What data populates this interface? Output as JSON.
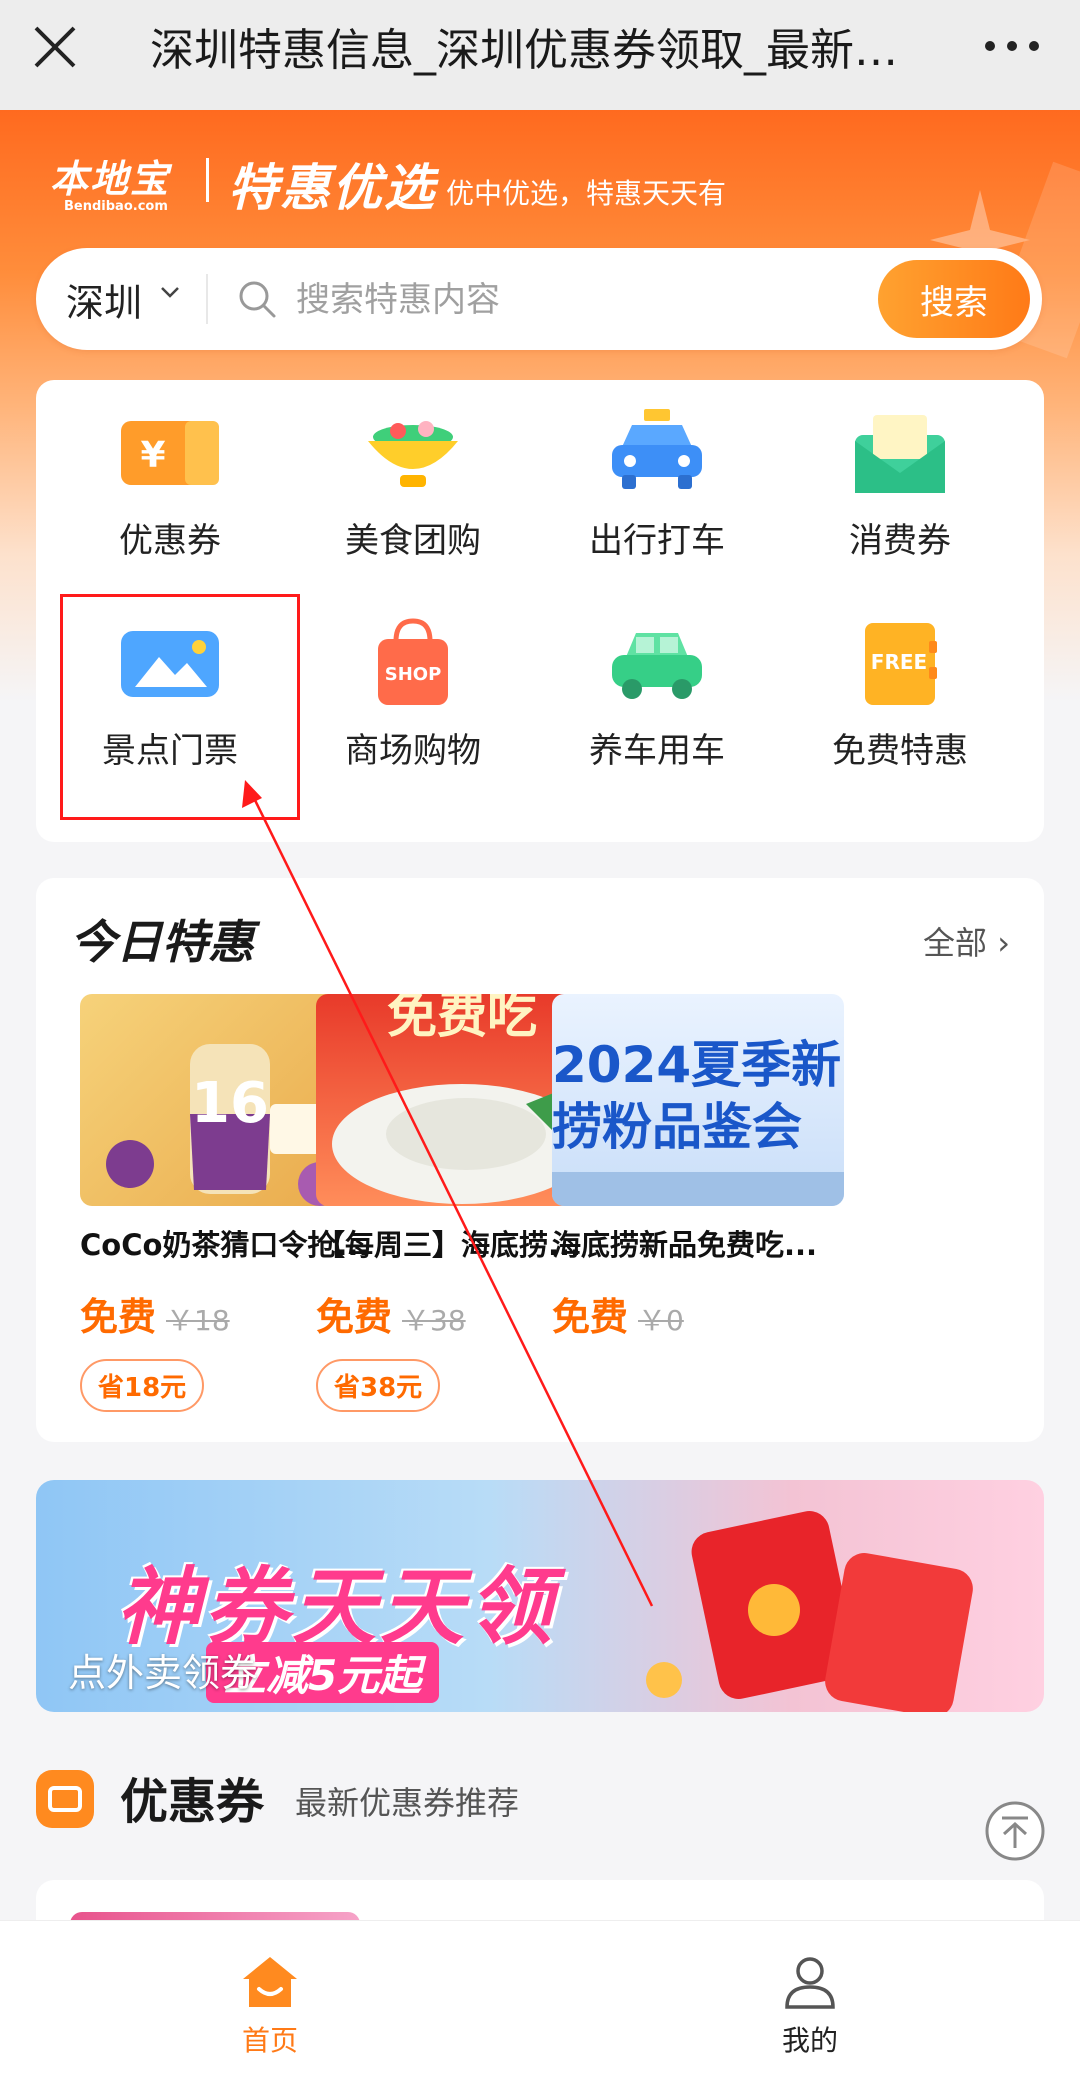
{
  "titlebar": {
    "title": "深圳特惠信息_深圳优惠券领取_最新深圳特惠活动"
  },
  "brand": {
    "logo_cn": "本地宝",
    "logo_en": "Bendibao.com",
    "title": "特惠优选",
    "slogan": "优中优选，特惠天天有"
  },
  "search": {
    "city": "深圳",
    "placeholder": "搜索特惠内容",
    "button": "搜索"
  },
  "categories": [
    {
      "label": "优惠券",
      "icon": "coupon-ticket-icon"
    },
    {
      "label": "美食团购",
      "icon": "food-bowl-icon"
    },
    {
      "label": "出行打车",
      "icon": "taxi-icon"
    },
    {
      "label": "消费券",
      "icon": "voucher-envelope-icon"
    },
    {
      "label": "景点门票",
      "icon": "scenery-photo-icon"
    },
    {
      "label": "商场购物",
      "icon": "shopping-bag-icon",
      "badge": "SHOP"
    },
    {
      "label": "养车用车",
      "icon": "car-icon"
    },
    {
      "label": "免费特惠",
      "icon": "free-notebook-icon",
      "badge": "FREE"
    }
  ],
  "today": {
    "title": "今日特惠",
    "all_link": "全部",
    "deals": [
      {
        "name": "CoCo奶茶猜口令抢...",
        "price": "免费",
        "original": "￥18",
        "save": "省18元",
        "thumb_text": "16"
      },
      {
        "name": "【每周三】海底捞...",
        "price": "免费",
        "original": "￥38",
        "save": "省38元",
        "thumb_text": "免费吃"
      },
      {
        "name": "海底捞新品免费吃...",
        "price": "免费",
        "original": "￥0",
        "thumb_text_1": "2024夏季新",
        "thumb_text_2": "捞粉品鉴会"
      }
    ]
  },
  "banner": {
    "headline": "神券天天领",
    "sub": "立减5元起",
    "caption": "点外卖领券"
  },
  "coupons": {
    "title": "优惠券",
    "subtitle": "最新优惠券推荐"
  },
  "bottom_nav": [
    {
      "label": "首页",
      "icon": "home-icon",
      "active": true
    },
    {
      "label": "我的",
      "icon": "profile-icon",
      "active": false
    }
  ],
  "colors": {
    "brand": "#ff6a1f",
    "price": "#ff6a00",
    "annotation": "#ff1a1a"
  }
}
